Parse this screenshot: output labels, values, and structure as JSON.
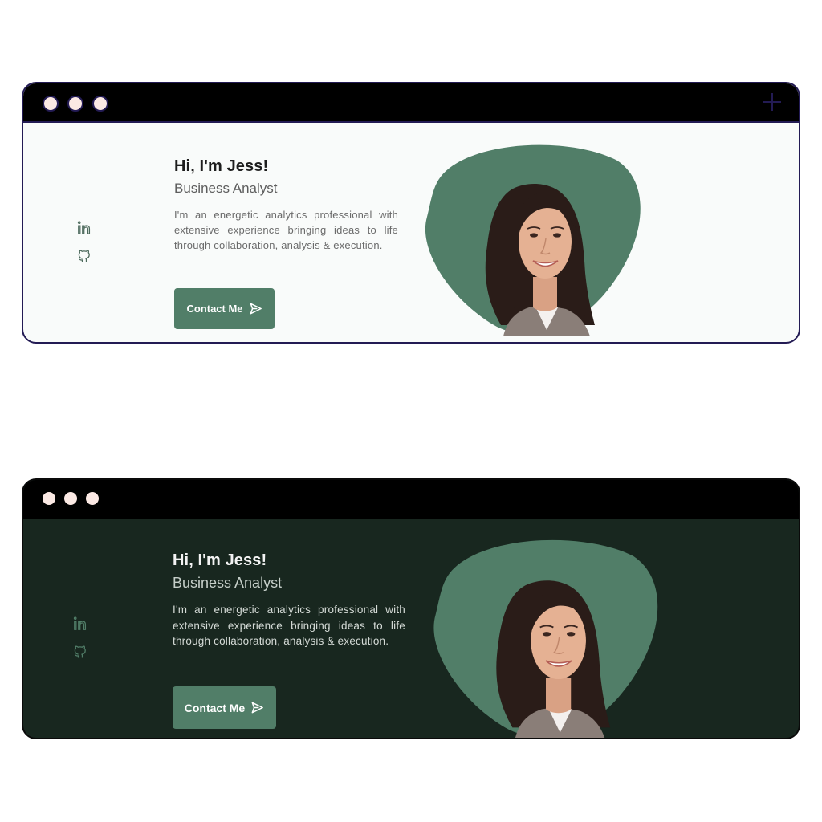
{
  "hero": {
    "greeting": "Hi, I'm Jess!",
    "role": "Business Analyst",
    "bio": "I'm an energetic analytics professional with extensive experience bringing ideas to life through collaboration, analysis & execution.",
    "cta_label": "Contact Me"
  },
  "social": [
    {
      "icon": "linkedin-icon"
    },
    {
      "icon": "github-icon"
    }
  ],
  "icons": {
    "cta": "send-icon",
    "window_dots": "dot-icon",
    "new_tab": "plus-icon"
  },
  "colors": {
    "accent": "#517e68",
    "light_background": "#f9fbfa",
    "dark_background": "#18271f",
    "titlebar": "#000000",
    "dot": "#fbe9e4",
    "window_outline_light": "#231b54"
  }
}
